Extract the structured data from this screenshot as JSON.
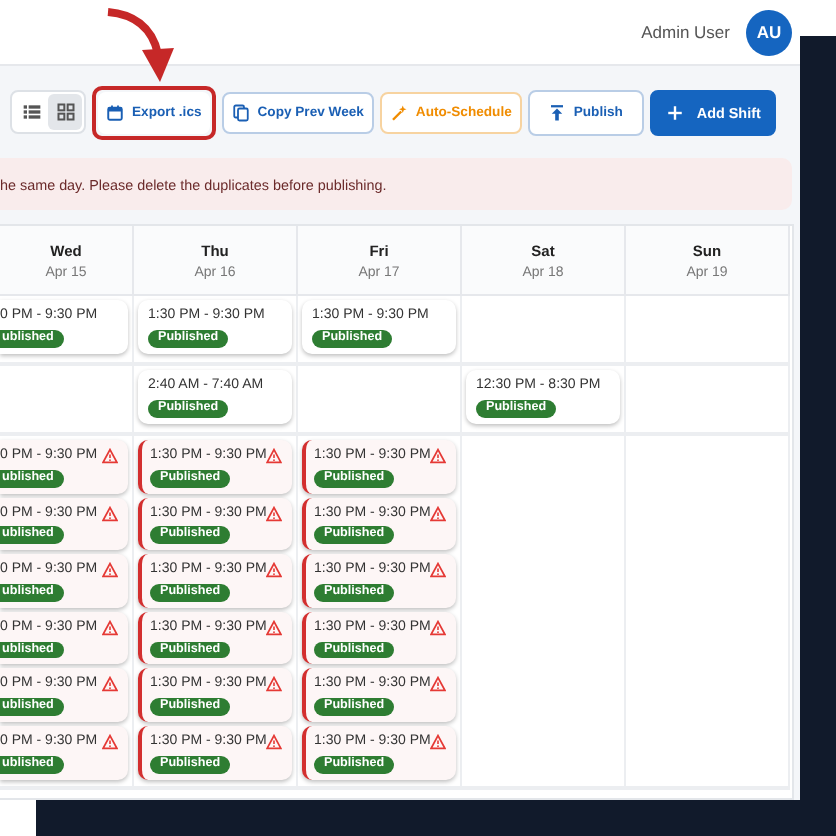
{
  "header": {
    "user_name": "Admin User",
    "avatar_initials": "AU"
  },
  "toolbar": {
    "view_toggles": [
      {
        "kind": "list",
        "selected": false
      },
      {
        "kind": "grid",
        "selected": true
      }
    ],
    "buttons": [
      {
        "kind": "export",
        "label": "Export .ics",
        "highlighted": true
      },
      {
        "kind": "copy",
        "label": "Copy Prev Week",
        "highlighted": false
      },
      {
        "kind": "auto",
        "label": "Auto-Schedule",
        "highlighted": false
      },
      {
        "kind": "publish",
        "label": "Publish",
        "highlighted": false
      },
      {
        "kind": "add",
        "label": "Add Shift",
        "highlighted": false
      }
    ]
  },
  "banner": {
    "text": "he same day. Please delete the duplicates before publishing."
  },
  "days": [
    {
      "day": "Wed",
      "date": "Apr 15"
    },
    {
      "day": "Thu",
      "date": "Apr 16"
    },
    {
      "day": "Fri",
      "date": "Apr 17"
    },
    {
      "day": "Sat",
      "date": "Apr 18"
    },
    {
      "day": "Sun",
      "date": "Apr 19"
    }
  ],
  "rows": [
    {
      "cells": [
        [
          {
            "time": "0 PM - 9:30 PM",
            "status": "ublished",
            "conflict": false
          }
        ],
        [
          {
            "time": "1:30 PM - 9:30 PM",
            "status": "Published",
            "conflict": false
          }
        ],
        [
          {
            "time": "1:30 PM - 9:30 PM",
            "status": "Published",
            "conflict": false
          }
        ],
        [],
        []
      ]
    },
    {
      "cells": [
        [],
        [
          {
            "time": "2:40 AM - 7:40 AM",
            "status": "Published",
            "conflict": false
          }
        ],
        [],
        [
          {
            "time": "12:30 PM - 8:30 PM",
            "status": "Published",
            "conflict": false
          }
        ],
        []
      ]
    },
    {
      "cells": [
        [
          {
            "time": "0 PM - 9:30 PM",
            "status": "ublished",
            "conflict": true
          },
          {
            "time": "0 PM - 9:30 PM",
            "status": "ublished",
            "conflict": true
          },
          {
            "time": "0 PM - 9:30 PM",
            "status": "ublished",
            "conflict": true
          },
          {
            "time": "0 PM - 9:30 PM",
            "status": "ublished",
            "conflict": true
          },
          {
            "time": "0 PM - 9:30 PM",
            "status": "ublished",
            "conflict": true
          },
          {
            "time": "0 PM - 9:30 PM",
            "status": "ublished",
            "conflict": true
          }
        ],
        [
          {
            "time": "1:30 PM - 9:30 PM",
            "status": "Published",
            "conflict": true
          },
          {
            "time": "1:30 PM - 9:30 PM",
            "status": "Published",
            "conflict": true
          },
          {
            "time": "1:30 PM - 9:30 PM",
            "status": "Published",
            "conflict": true
          },
          {
            "time": "1:30 PM - 9:30 PM",
            "status": "Published",
            "conflict": true
          },
          {
            "time": "1:30 PM - 9:30 PM",
            "status": "Published",
            "conflict": true
          },
          {
            "time": "1:30 PM - 9:30 PM",
            "status": "Published",
            "conflict": true
          }
        ],
        [
          {
            "time": "1:30 PM - 9:30 PM",
            "status": "Published",
            "conflict": true
          },
          {
            "time": "1:30 PM - 9:30 PM",
            "status": "Published",
            "conflict": true
          },
          {
            "time": "1:30 PM - 9:30 PM",
            "status": "Published",
            "conflict": true
          },
          {
            "time": "1:30 PM - 9:30 PM",
            "status": "Published",
            "conflict": true
          },
          {
            "time": "1:30 PM - 9:30 PM",
            "status": "Published",
            "conflict": true
          },
          {
            "time": "1:30 PM - 9:30 PM",
            "status": "Published",
            "conflict": true
          }
        ],
        [],
        []
      ]
    }
  ]
}
